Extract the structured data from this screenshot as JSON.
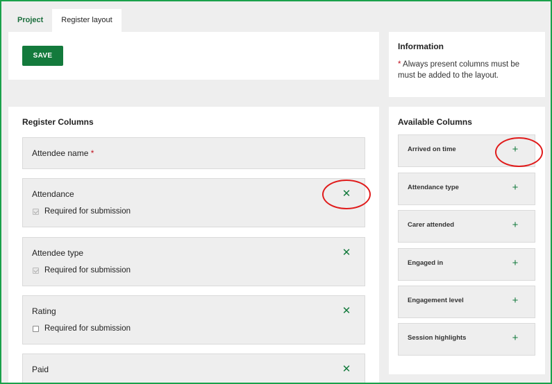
{
  "tabs": [
    {
      "label": "Project"
    },
    {
      "label": "Register layout"
    }
  ],
  "toolbar": {
    "save_label": "SAVE"
  },
  "info": {
    "title": "Information",
    "star": "*",
    "text": " Always present columns must be must be added to the layout."
  },
  "register": {
    "title": "Register Columns",
    "always_present": {
      "name": "Attendee name",
      "star": "*"
    },
    "columns": [
      {
        "name": "Attendance",
        "remove_icon": "✕",
        "required_label": "Required for submission",
        "required": true
      },
      {
        "name": "Attendee type",
        "remove_icon": "✕",
        "required_label": "Required for submission",
        "required": true
      },
      {
        "name": "Rating",
        "remove_icon": "✕",
        "required_label": "Required for submission",
        "required": false
      },
      {
        "name": "Paid",
        "remove_icon": "✕"
      }
    ]
  },
  "available": {
    "title": "Available Columns",
    "add_icon": "+",
    "items": [
      {
        "name": "Arrived on time"
      },
      {
        "name": "Attendance type"
      },
      {
        "name": "Carer attended"
      },
      {
        "name": "Engaged in"
      },
      {
        "name": "Engagement level"
      },
      {
        "name": "Session highlights"
      }
    ]
  },
  "colors": {
    "accent": "#137a3c",
    "required_star": "#c1121f",
    "frame_border": "#1aa14a",
    "annotation": "#e01b1b"
  }
}
